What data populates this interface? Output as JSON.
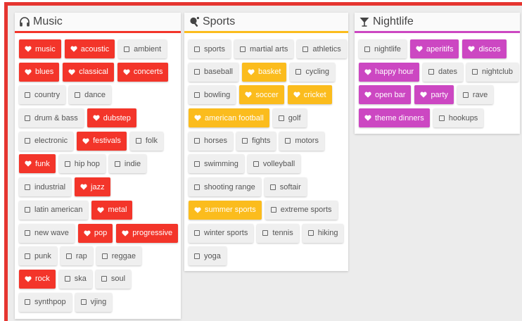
{
  "colors": {
    "frame": "#e53530",
    "music": "#f3352a",
    "sports": "#fbbc1d",
    "nightlife": "#cc47c2",
    "off_bg": "#efefef"
  },
  "panels": [
    {
      "id": "music",
      "title": "Music",
      "icon": "headphones-icon",
      "accent": "#f3352a",
      "rows": [
        [
          {
            "label": "music",
            "on": true
          },
          {
            "label": "acoustic",
            "on": true
          },
          {
            "label": "ambient",
            "on": false
          }
        ],
        [
          {
            "label": "blues",
            "on": true
          },
          {
            "label": "classical",
            "on": true
          },
          {
            "label": "concerts",
            "on": true
          }
        ],
        [
          {
            "label": "country",
            "on": false
          },
          {
            "label": "dance",
            "on": false
          }
        ],
        [
          {
            "label": "drum & bass",
            "on": false
          },
          {
            "label": "dubstep",
            "on": true
          }
        ],
        [
          {
            "label": "electronic",
            "on": false
          },
          {
            "label": "festivals",
            "on": true
          },
          {
            "label": "folk",
            "on": false
          }
        ],
        [
          {
            "label": "funk",
            "on": true
          },
          {
            "label": "hip hop",
            "on": false
          },
          {
            "label": "indie",
            "on": false
          }
        ],
        [
          {
            "label": "industrial",
            "on": false
          },
          {
            "label": "jazz",
            "on": true
          }
        ],
        [
          {
            "label": "latin american",
            "on": false
          },
          {
            "label": "metal",
            "on": true
          }
        ],
        [
          {
            "label": "new wave",
            "on": false
          },
          {
            "label": "pop",
            "on": true
          },
          {
            "label": "progressive",
            "on": true
          }
        ],
        [
          {
            "label": "punk",
            "on": false
          },
          {
            "label": "rap",
            "on": false
          },
          {
            "label": "reggae",
            "on": false
          }
        ],
        [
          {
            "label": "rock",
            "on": true
          },
          {
            "label": "ska",
            "on": false
          },
          {
            "label": "soul",
            "on": false
          }
        ],
        [
          {
            "label": "synthpop",
            "on": false
          },
          {
            "label": "vjing",
            "on": false
          }
        ]
      ]
    },
    {
      "id": "sports",
      "title": "Sports",
      "icon": "ping-pong-paddle-icon",
      "accent": "#fbbc1d",
      "rows": [
        [
          {
            "label": "sports",
            "on": false
          },
          {
            "label": "martial arts",
            "on": false
          },
          {
            "label": "athletics",
            "on": false
          }
        ],
        [
          {
            "label": "baseball",
            "on": false
          },
          {
            "label": "basket",
            "on": true
          },
          {
            "label": "cycling",
            "on": false
          }
        ],
        [
          {
            "label": "bowling",
            "on": false
          },
          {
            "label": "soccer",
            "on": true
          },
          {
            "label": "cricket",
            "on": true
          }
        ],
        [
          {
            "label": "american football",
            "on": true
          },
          {
            "label": "golf",
            "on": false
          }
        ],
        [
          {
            "label": "horses",
            "on": false
          },
          {
            "label": "fights",
            "on": false
          },
          {
            "label": "motors",
            "on": false
          }
        ],
        [
          {
            "label": "swimming",
            "on": false
          },
          {
            "label": "volleyball",
            "on": false
          }
        ],
        [
          {
            "label": "shooting range",
            "on": false
          },
          {
            "label": "softair",
            "on": false
          }
        ],
        [
          {
            "label": "summer sports",
            "on": true
          },
          {
            "label": "extreme sports",
            "on": false
          }
        ],
        [
          {
            "label": "winter sports",
            "on": false
          },
          {
            "label": "tennis",
            "on": false
          },
          {
            "label": "hiking",
            "on": false
          }
        ],
        [
          {
            "label": "yoga",
            "on": false
          }
        ]
      ]
    },
    {
      "id": "nightlife",
      "title": "Nightlife",
      "icon": "cocktail-glass-icon",
      "accent": "#cc47c2",
      "rows": [
        [
          {
            "label": "nightlife",
            "on": false
          },
          {
            "label": "aperitifs",
            "on": true
          },
          {
            "label": "discos",
            "on": true
          }
        ],
        [
          {
            "label": "happy hour",
            "on": true
          },
          {
            "label": "dates",
            "on": false
          },
          {
            "label": "nightclub",
            "on": false
          }
        ],
        [
          {
            "label": "open bar",
            "on": true
          },
          {
            "label": "party",
            "on": true
          },
          {
            "label": "rave",
            "on": false
          }
        ],
        [
          {
            "label": "theme dinners",
            "on": true
          },
          {
            "label": "hookups",
            "on": false
          }
        ]
      ]
    }
  ]
}
